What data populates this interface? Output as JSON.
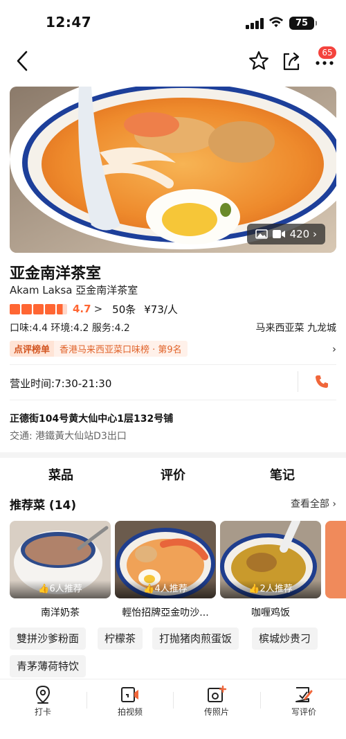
{
  "status_bar": {
    "time": "12:47",
    "battery": "75"
  },
  "nav": {
    "notification_count": "65"
  },
  "hero": {
    "photo_count": "420 ›"
  },
  "shop": {
    "name": "亚金南洋茶室",
    "subname": "Akam Laksa 亞金南洋茶室",
    "rating": "4.7",
    "rating_chevron": ">",
    "review_count": "50条",
    "price": "¥73/人",
    "sub_scores": "口味:4.4 环境:4.2 服务:4.2",
    "cuisine_area": "马来西亚菜 九龙城",
    "rank_tag": "点评榜单",
    "rank_text": "香港马来西亚菜口味榜 · 第9名",
    "rank_chevron": "›",
    "hours": "营业时间:7:30-21:30",
    "address": "正德街104号黄大仙中心1层132号铺",
    "transit": "交通: 港鐵黃大仙站D3出口"
  },
  "tabs": [
    {
      "label": "菜品",
      "active": true
    },
    {
      "label": "评价",
      "active": false
    },
    {
      "label": "笔记",
      "active": false
    }
  ],
  "recommended": {
    "title": "推荐菜 (14)",
    "see_all": "查看全部 ›",
    "dishes": [
      {
        "name": "南洋奶茶",
        "recommend": "👍6人推荐"
      },
      {
        "name": "輕怡招牌亞金叻沙...",
        "recommend": "👍4人推荐"
      },
      {
        "name": "咖喱鸡饭",
        "recommend": "👍2人推荐"
      }
    ]
  },
  "dish_chips": [
    "雙拼沙爹粉面",
    "柠檬茶",
    "打抛猪肉煎蛋饭",
    "槟城炒贵刁",
    "青茅薄荷特饮"
  ],
  "bottom_bar": [
    {
      "label": "打卡",
      "icon": "location-pin-icon"
    },
    {
      "label": "拍视频",
      "icon": "video-camera-icon"
    },
    {
      "label": "传照片",
      "icon": "photo-upload-icon"
    },
    {
      "label": "写评价",
      "icon": "write-review-icon"
    }
  ],
  "colors": {
    "accent": "#ff6633",
    "badge": "#f4433d"
  }
}
